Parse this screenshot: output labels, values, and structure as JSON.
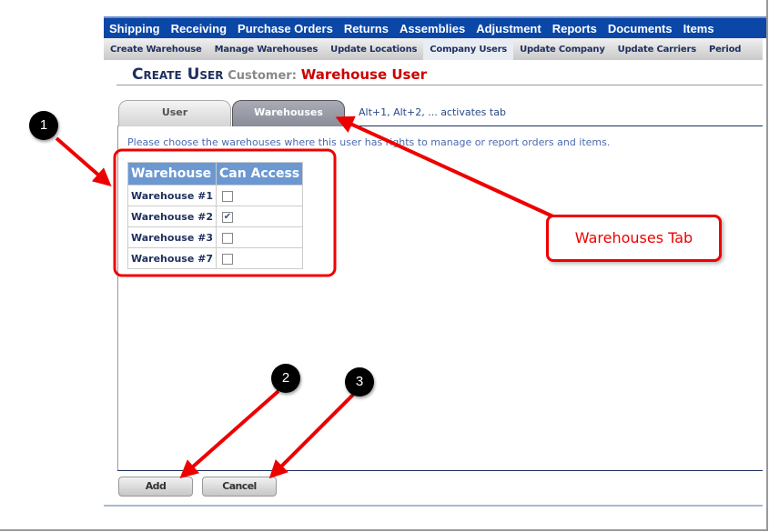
{
  "nav": {
    "items": [
      "Shipping",
      "Receiving",
      "Purchase Orders",
      "Returns",
      "Assemblies",
      "Adjustment",
      "Reports",
      "Documents",
      "Items"
    ]
  },
  "subnav": {
    "items": [
      "Create Warehouse",
      "Manage Warehouses",
      "Update Locations",
      "Company Users",
      "Update Company",
      "Update Carriers",
      "Period"
    ],
    "active": "Company Users"
  },
  "header": {
    "title": "Create User",
    "customer_label": "Customer:",
    "customer_value": "Warehouse User"
  },
  "tabs": [
    {
      "label": "User"
    },
    {
      "label": "Warehouses",
      "active": true
    }
  ],
  "tab_hint": "Alt+1, Alt+2, ... activates tab",
  "instructions": "Please choose the warehouses where this user has rights to manage or report orders and items.",
  "table": {
    "headers": [
      "Warehouse",
      "Can Access"
    ],
    "rows": [
      {
        "name": "Warehouse #1",
        "checked": false
      },
      {
        "name": "Warehouse #2",
        "checked": true
      },
      {
        "name": "Warehouse #3",
        "checked": false
      },
      {
        "name": "Warehouse #7",
        "checked": false
      }
    ]
  },
  "buttons": {
    "add": "Add",
    "cancel": "Cancel"
  },
  "annotations": {
    "callout": "Warehouses Tab",
    "markers": [
      "1",
      "2",
      "3"
    ],
    "color": "#ee0000"
  }
}
